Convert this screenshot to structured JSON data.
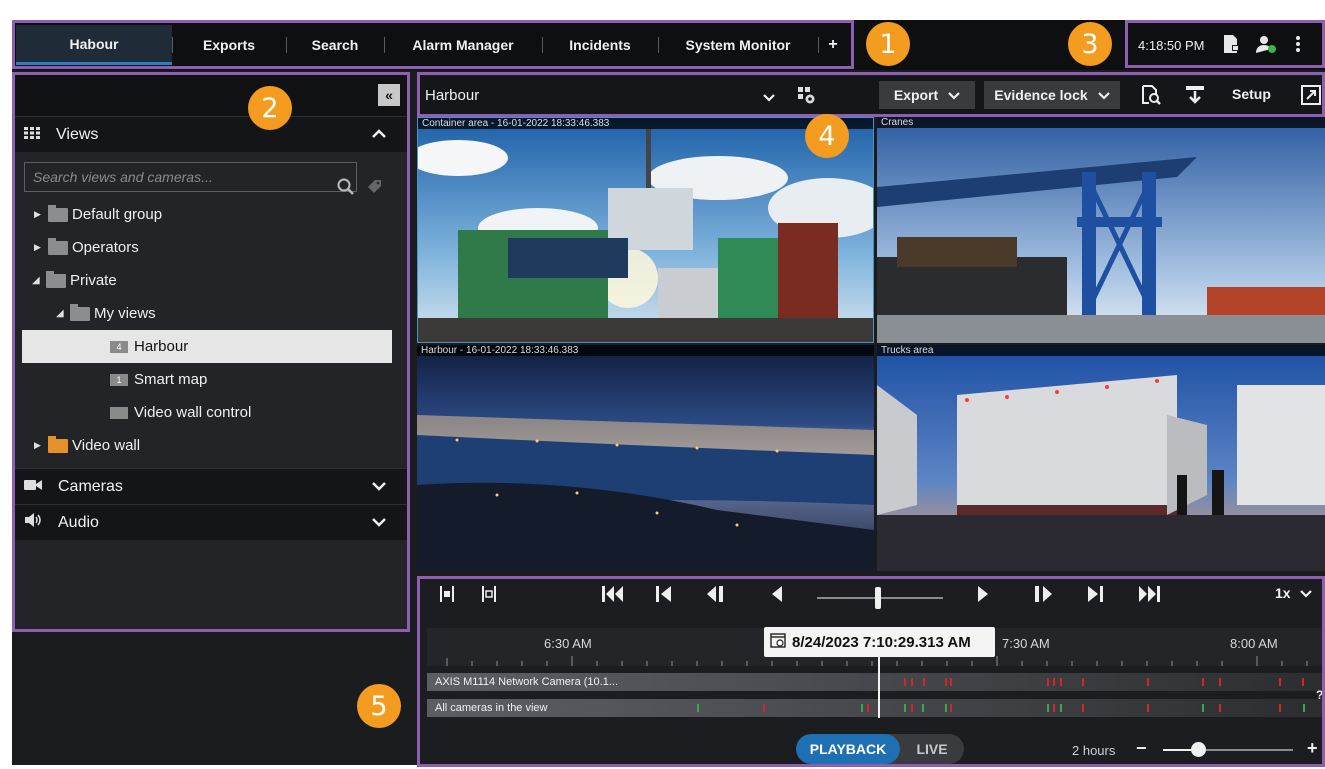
{
  "tabs": [
    "Habour",
    "Exports",
    "Search",
    "Alarm Manager",
    "Incidents",
    "System Monitor",
    "+"
  ],
  "status": {
    "time": "4:18:50 PM"
  },
  "badges": [
    "1",
    "2",
    "3",
    "4",
    "5"
  ],
  "left_panel": {
    "views_header": "Views",
    "search_placeholder": "Search views and cameras...",
    "tree": [
      {
        "label": "Default group"
      },
      {
        "label": "Operators"
      },
      {
        "label": "Private"
      },
      {
        "label": "My views"
      },
      {
        "label": "Harbour",
        "num": "4"
      },
      {
        "label": "Smart map",
        "num": "1"
      },
      {
        "label": "Video wall control"
      },
      {
        "label": "Video wall"
      }
    ],
    "cameras_header": "Cameras",
    "audio_header": "Audio"
  },
  "toolbar": {
    "view_name": "Harbour",
    "export": "Export",
    "evidence_lock": "Evidence lock",
    "setup": "Setup"
  },
  "cameras": [
    {
      "title": "Container area - 16-01-2022 18:33:46.383"
    },
    {
      "title": "Cranes"
    },
    {
      "title": "Harbour - 16-01-2022 18:33:46.383"
    },
    {
      "title": "Trucks area"
    }
  ],
  "playback": {
    "speed": "1x",
    "timestamp": "8/24/2023 7:10:29.313 AM",
    "ticks": [
      "6:30 AM",
      "7:30 AM",
      "8:00 AM"
    ],
    "tracks": [
      "AXIS M1114 Network Camera (10.1...",
      "All cameras in the view"
    ],
    "mode_playback": "PLAYBACK",
    "mode_live": "LIVE",
    "span": "2 hours",
    "zoom_minus": "−",
    "zoom_plus": "+",
    "help": "?"
  }
}
